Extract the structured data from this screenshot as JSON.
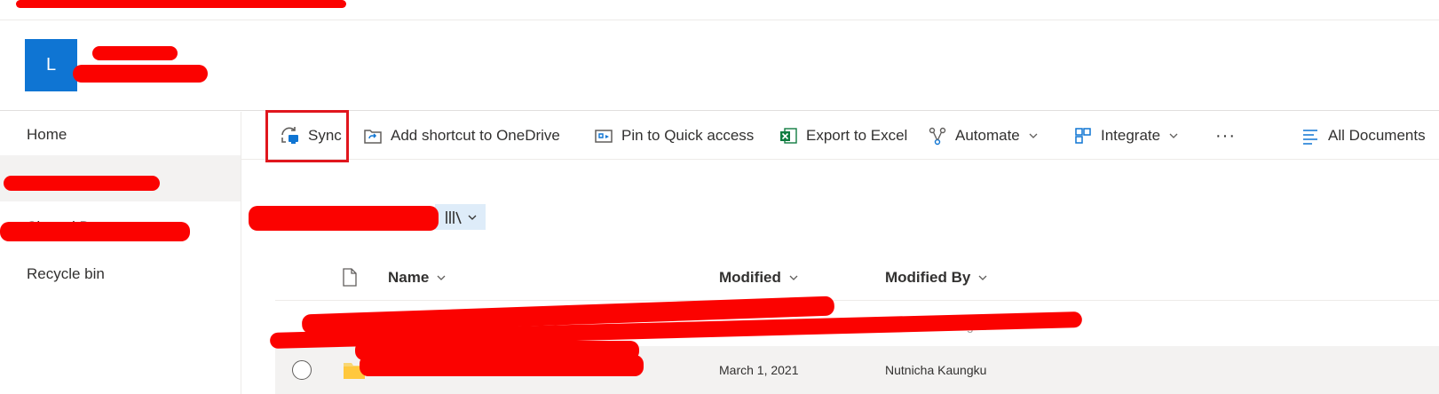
{
  "site": {
    "logo_letter": "L"
  },
  "nav": {
    "items": [
      {
        "label": "Home"
      },
      {
        "label": ""
      },
      {
        "label": "Shared Documents"
      },
      {
        "label": "Recycle bin"
      }
    ]
  },
  "commands": {
    "sync": "Sync",
    "add_shortcut": "Add shortcut to OneDrive",
    "pin": "Pin to Quick access",
    "export": "Export to Excel",
    "automate": "Automate",
    "integrate": "Integrate",
    "more": "···",
    "view": "All Documents"
  },
  "list": {
    "columns": {
      "name": "Name",
      "modified": "Modified",
      "modified_by": "Modified By"
    },
    "rows": [
      {
        "modified": "",
        "modified_by": "Nutnicha Kaungku"
      },
      {
        "modified": "March 1, 2021",
        "modified_by": "Nutnicha Kaungku"
      }
    ]
  },
  "colors": {
    "brand": "#0f75d3",
    "highlight": "#e0161d",
    "redaction": "#fb0200"
  },
  "icons": [
    "sync-icon",
    "shortcut-icon",
    "pin-icon",
    "excel-icon",
    "automate-icon",
    "integrate-icon",
    "more-icon",
    "view-list-icon",
    "document-icon",
    "folder-icon",
    "chevron-down-icon",
    "library-icon"
  ]
}
